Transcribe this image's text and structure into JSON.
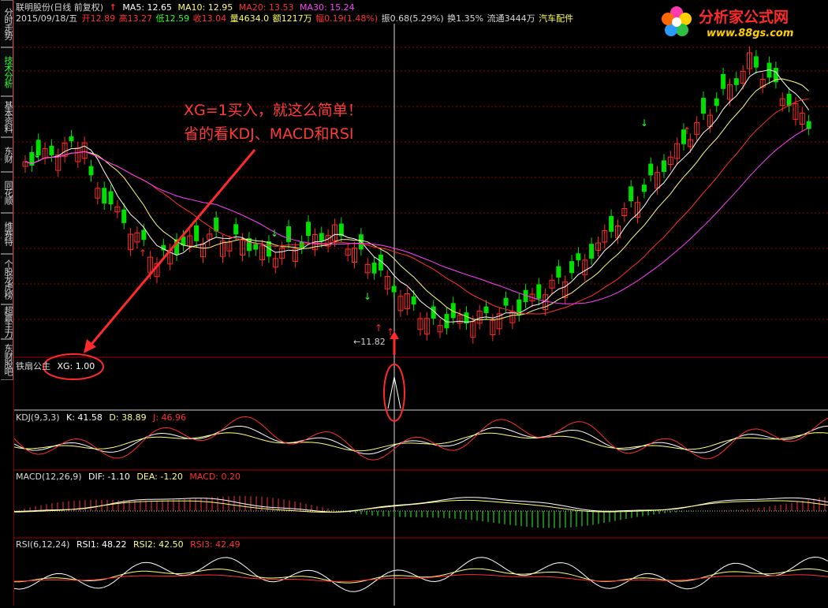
{
  "sidebar": {
    "tabs": [
      {
        "label": "分时走势",
        "active": false
      },
      {
        "label": "技术分析",
        "active": true
      },
      {
        "label": "基本资料",
        "active": false
      },
      {
        "label": "东财10",
        "active": false
      },
      {
        "label": "同花顺10",
        "active": false
      },
      {
        "label": "维赛特10",
        "active": false
      },
      {
        "label": "个股龙虎榜",
        "active": false
      },
      {
        "label": "超赢主力",
        "active": false
      },
      {
        "label": "东财股吧",
        "active": false
      }
    ]
  },
  "header": {
    "title": "联明股份(日线 前复权)",
    "ma_arrow": "↑",
    "ma5": "MA5: 12.65",
    "ma10": "MA10: 12.95",
    "ma20": "MA20: 13.53",
    "ma30": "MA30: 15.24",
    "date": "2015/09/18/五",
    "open": "开12.89",
    "high": "高13.27",
    "low": "低12.59",
    "close": "收13.04",
    "volume": "量4634.0",
    "amount": "额1217万",
    "change": "幅0.19(1.48%)",
    "amplitude": "振0.68(5.29%)",
    "turnover": "换1.35%",
    "float_shares": "流通3444万",
    "industry": "汽车配件"
  },
  "logo": {
    "text": "分析家公式网",
    "url_text": "www.88gs.com"
  },
  "annotation": {
    "line1": "XG=1买入，就这么简单！",
    "line2": "省的看KDJ、MACD和RSI"
  },
  "price_min_label": "11.82",
  "xg_panel": {
    "name": "铁扇公主",
    "label": "XG: 1.00"
  },
  "kdj_panel": {
    "name": "KDJ(9,3,3)",
    "k": "K: 41.58",
    "d": "D: 38.89",
    "j": "J: 46.96"
  },
  "macd_panel": {
    "name": "MACD(12,26,9)",
    "dif": "DIF: -1.10",
    "dea": "DEA: -1.20",
    "macd": "MACD: 0.20"
  },
  "rsi_panel": {
    "name": "RSI(6,12,24)",
    "rsi1": "RSI1: 48.22",
    "rsi2": "RSI2: 42.50",
    "rsi3": "RSI3: 42.49"
  },
  "colors": {
    "up": "#ff2a2a",
    "down": "#00e000",
    "ma5": "#ffffff",
    "ma10": "#ffff80",
    "ma20": "#ff3030",
    "ma30": "#ff40ff",
    "grid": "#900000"
  }
}
